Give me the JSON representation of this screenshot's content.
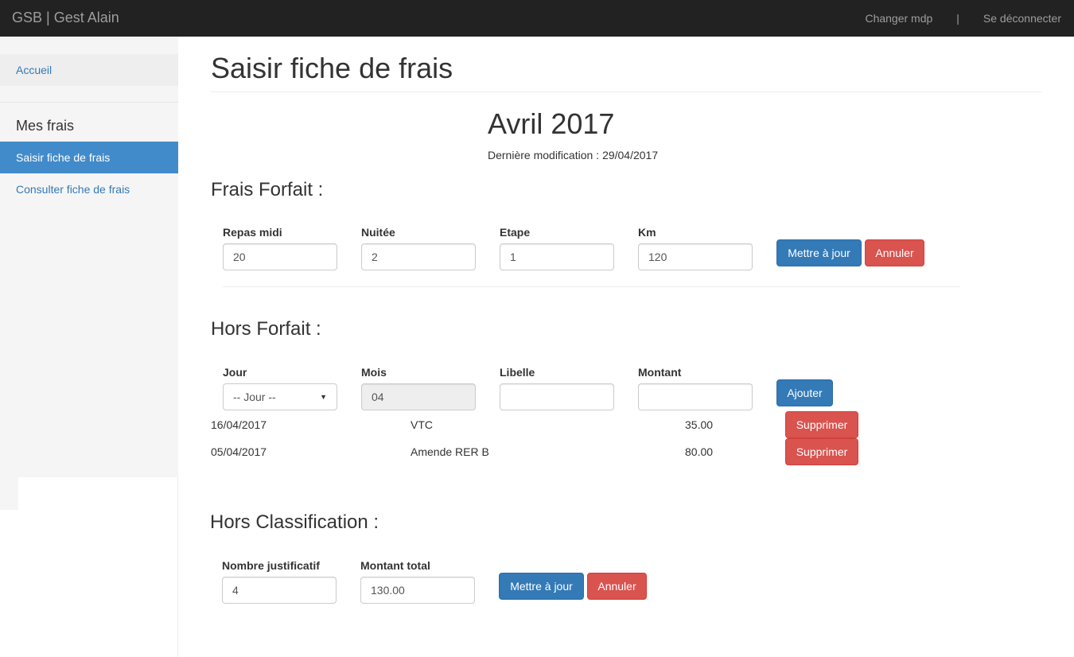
{
  "navbar": {
    "brand": "GSB | Gest Alain",
    "change_password": "Changer mdp",
    "separator": "|",
    "logout": "Se déconnecter"
  },
  "sidebar": {
    "home": "Accueil",
    "section_header": "Mes frais",
    "items": [
      {
        "label": "Saisir fiche de frais",
        "active": true
      },
      {
        "label": "Consulter fiche de frais",
        "active": false
      }
    ]
  },
  "page": {
    "title": "Saisir fiche de frais",
    "month": "Avril 2017",
    "last_modified_label": "Dernière modification :",
    "last_modified_value": "29/04/2017"
  },
  "frais_forfait": {
    "title": "Frais Forfait :",
    "fields": [
      {
        "label": "Repas midi",
        "value": "20"
      },
      {
        "label": "Nuitée",
        "value": "2"
      },
      {
        "label": "Etape",
        "value": "1"
      },
      {
        "label": "Km",
        "value": "120"
      }
    ],
    "update_button": "Mettre à jour",
    "cancel_button": "Annuler"
  },
  "hors_forfait": {
    "title": "Hors Forfait :",
    "labels": {
      "jour": "Jour",
      "mois": "Mois",
      "libelle": "Libelle",
      "montant": "Montant"
    },
    "jour_selected": "-- Jour --",
    "mois_value": "04",
    "libelle_value": "",
    "montant_value": "",
    "add_button": "Ajouter",
    "rows": [
      {
        "date": "16/04/2017",
        "libelle": "VTC",
        "montant": "35.00",
        "delete_label": "Supprimer"
      },
      {
        "date": "05/04/2017",
        "libelle": "Amende RER B",
        "montant": "80.00",
        "delete_label": "Supprimer"
      }
    ]
  },
  "hors_classification": {
    "title": "Hors Classification :",
    "fields": [
      {
        "label": "Nombre justificatif",
        "value": "4"
      },
      {
        "label": "Montant total",
        "value": "130.00"
      }
    ],
    "update_button": "Mettre à jour",
    "cancel_button": "Annuler"
  },
  "colors": {
    "navbar_bg": "#222222",
    "primary": "#337ab7",
    "danger": "#d9534f",
    "sidebar_active": "#428bca"
  }
}
